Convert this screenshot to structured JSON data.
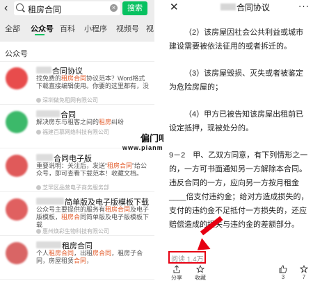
{
  "search": {
    "query": "租房合同",
    "button_label": "搜索"
  },
  "tabs": [
    "全部",
    "公众号",
    "百科",
    "小程序",
    "视频号",
    "视"
  ],
  "section_title": "公众号",
  "results": [
    {
      "title": "合同协议",
      "desc": [
        "找免费的",
        "租房合同",
        "协议范本？Word格式下载直接编辑使用。你要的这里都有，没"
      ],
      "source": "深圳做免租网有限公司",
      "avatar_color": "#e84c4c"
    },
    {
      "title": "合同",
      "desc": [
        "解决房东与租客之间的",
        "租房",
        "纠纷"
      ],
      "source": "福建百慕网络科技有限公司",
      "avatar_color": "#3cb96a"
    },
    {
      "title": "合同电子版",
      "desc": [
        "重要说明：关注后，发送“",
        "租房合同",
        "”给公众号，即可查看下载范本！收藏文档。"
      ],
      "source": "芝罘区品营电子商务服务部",
      "avatar_color": "#e05a5a"
    },
    {
      "title": "简单版及电子版模板下载",
      "desc": [
        "公众号主要提供的服务有",
        "租房合同",
        "及电子版模板，",
        "租房合",
        "同简单版及电子版模板下载"
      ],
      "source": "惠州焕彩生物科技有限公司",
      "avatar_color": "#e06060"
    },
    {
      "title": "租房合同",
      "desc": [
        "个人",
        "租房合同",
        "，出租",
        "房合同",
        "，租房子合同，房屋租赁",
        "合同",
        "，"
      ],
      "source": "",
      "avatar_color": "#d96565"
    }
  ],
  "watermark": {
    "title": "偏门吧",
    "url": "www.pianmenwz.com"
  },
  "article": {
    "title": "合同协议",
    "paragraphs": [
      "（2）该房屋因社会公共利益或城市建设需要被依法征用的或者拆迁的。",
      "（3）该房屋毁损、灭失或者被鉴定为危险房屋的；",
      "（4）甲方已被告知该房屋出租前已设定抵押，现被处分的。",
      "9－2　甲、乙双方同意，有下列情形之一的，一方可书面通知另一方解除本合同。违反合同的一方，应向另一方按月租金____倍支付违约金；给对方造成损失的，支付的违约金不足抵付一方损失的，还应赔偿造成的损失与违约金的差额部分。"
    ],
    "read_count": "阅读 1.4万",
    "actions": [
      {
        "label": "分享",
        "icon": "share-icon"
      },
      {
        "label": "收藏",
        "icon": "star-icon"
      },
      {
        "label": "3",
        "icon": "thumb-up-icon"
      },
      {
        "label": "7",
        "icon": "wow-icon"
      }
    ]
  },
  "colors": {
    "brand_green": "#07c160",
    "highlight_red": "#e60012",
    "keyword_orange": "#e35b2a"
  }
}
